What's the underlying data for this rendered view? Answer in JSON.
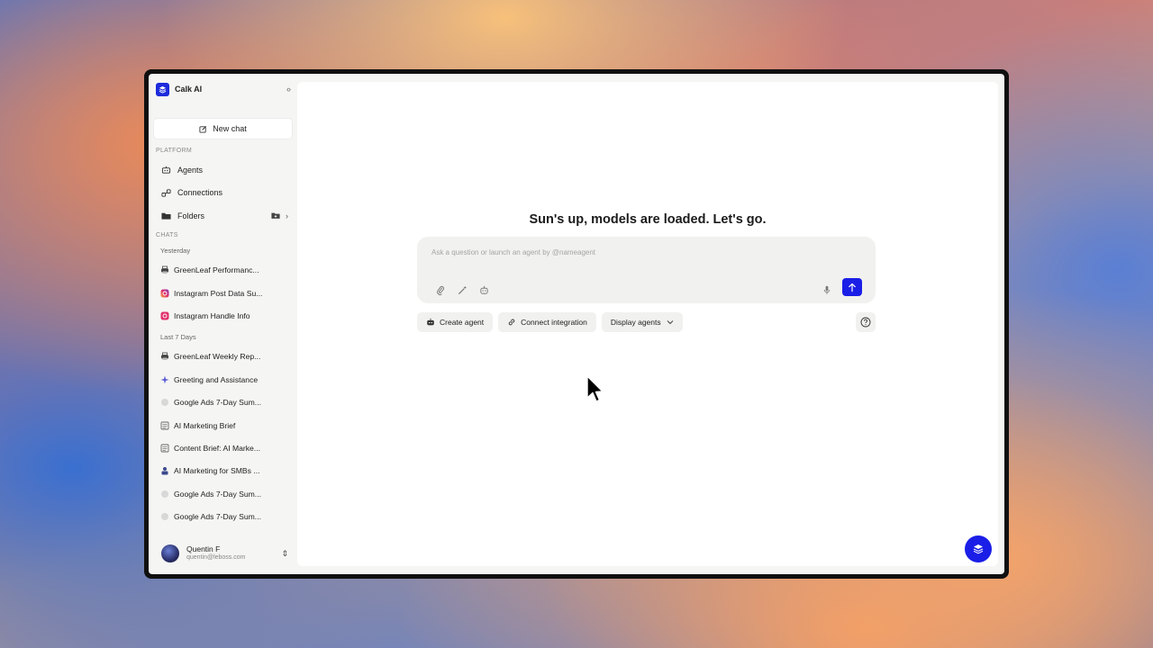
{
  "app": {
    "name": "Calk AI",
    "brand_color": "#1d2bdb",
    "accent_color": "#1b1ee6"
  },
  "sidebar": {
    "new_chat_label": "New chat",
    "platform_label": "PLATFORM",
    "platform_items": [
      {
        "label": "Agents",
        "icon": "robot-icon"
      },
      {
        "label": "Connections",
        "icon": "plug-icon"
      },
      {
        "label": "Folders",
        "icon": "folder-icon"
      }
    ],
    "chats_label": "CHATS",
    "groups": [
      {
        "label": "Yesterday",
        "items": [
          {
            "label": "GreenLeaf Performanc...",
            "icon": "printer-icon"
          },
          {
            "label": "Instagram Post Data Su...",
            "icon": "instagram-icon"
          },
          {
            "label": "Instagram Handle Info",
            "icon": "instagram-icon"
          }
        ]
      },
      {
        "label": "Last 7 Days",
        "items": [
          {
            "label": "GreenLeaf Weekly Rep...",
            "icon": "printer-icon"
          },
          {
            "label": "Greeting and Assistance",
            "icon": "sparkle-icon"
          },
          {
            "label": "Google Ads 7-Day Sum...",
            "icon": "dot-icon"
          },
          {
            "label": "AI Marketing Brief",
            "icon": "document-icon"
          },
          {
            "label": "Content Brief: AI Marke...",
            "icon": "document-icon"
          },
          {
            "label": "AI Marketing for SMBs ...",
            "icon": "person-icon"
          },
          {
            "label": "Google Ads 7-Day Sum...",
            "icon": "dot-icon"
          },
          {
            "label": "Google Ads 7-Day Sum...",
            "icon": "dot-icon"
          }
        ]
      }
    ],
    "user": {
      "name": "Quentin F",
      "email": "quentin@leboss.com"
    }
  },
  "main": {
    "headline": "Sun's up, models are loaded. Let's go.",
    "composer": {
      "placeholder": "Ask a question or launch an agent by @nameagent",
      "value": ""
    },
    "chips": {
      "create_agent": "Create agent",
      "connect_integration": "Connect integration",
      "display_agents": "Display agents"
    }
  }
}
